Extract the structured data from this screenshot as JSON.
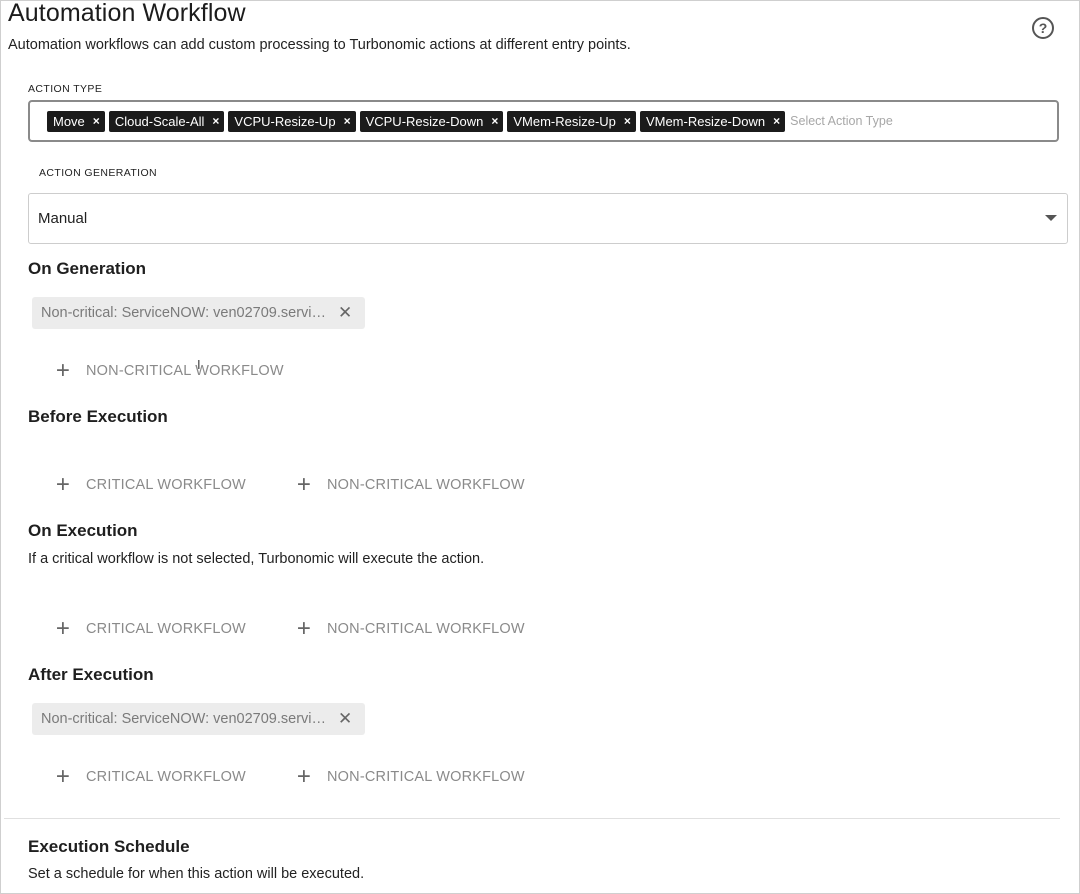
{
  "header": {
    "title": "Automation Workflow",
    "subtitle": "Automation workflows can add custom processing to Turbonomic actions at different entry points.",
    "help_icon": "?"
  },
  "action_type": {
    "label": "ACTION TYPE",
    "tags": [
      "Move",
      "Cloud-Scale-All",
      "VCPU-Resize-Up",
      "VCPU-Resize-Down",
      "VMem-Resize-Up",
      "VMem-Resize-Down"
    ],
    "remove_glyph": "×",
    "placeholder": "Select Action Type"
  },
  "action_generation": {
    "label": "ACTION GENERATION",
    "value": "Manual"
  },
  "sections": {
    "on_generation": {
      "title": "On Generation",
      "chip": "Non-critical: ServiceNOW: ven02709.servi…",
      "non_critical": "NON-CRITICAL WORKFLOW"
    },
    "before_execution": {
      "title": "Before Execution",
      "critical": "CRITICAL WORKFLOW",
      "non_critical": "NON-CRITICAL WORKFLOW"
    },
    "on_execution": {
      "title": "On Execution",
      "description": "If a critical workflow is not selected, Turbonomic will execute the action.",
      "critical": "CRITICAL WORKFLOW",
      "non_critical": "NON-CRITICAL WORKFLOW"
    },
    "after_execution": {
      "title": "After Execution",
      "chip": "Non-critical: ServiceNOW: ven02709.servi…",
      "critical": "CRITICAL WORKFLOW",
      "non_critical": "NON-CRITICAL WORKFLOW"
    },
    "execution_schedule": {
      "title": "Execution Schedule",
      "description": "Set a schedule for when this action will be executed."
    }
  },
  "glyphs": {
    "plus": "+",
    "close": "✕"
  }
}
